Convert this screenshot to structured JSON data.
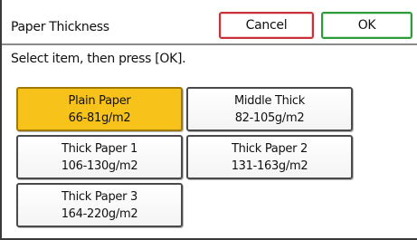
{
  "header": {
    "title": "Paper Thickness",
    "cancel_label": "Cancel",
    "ok_label": "OK"
  },
  "instruction": "Select item, then press [OK].",
  "options": [
    {
      "name": "Plain Paper",
      "range": "66-81g/m2",
      "selected": true
    },
    {
      "name": "Middle Thick",
      "range": "82-105g/m2",
      "selected": false
    },
    {
      "name": "Thick Paper 1",
      "range": "106-130g/m2",
      "selected": false
    },
    {
      "name": "Thick Paper 2",
      "range": "131-163g/m2",
      "selected": false
    },
    {
      "name": "Thick Paper 3",
      "range": "164-220g/m2",
      "selected": false
    }
  ],
  "colors": {
    "selected_fill": "#f7c21a",
    "cancel_border": "#c8313a",
    "ok_border": "#2f9a3c"
  }
}
